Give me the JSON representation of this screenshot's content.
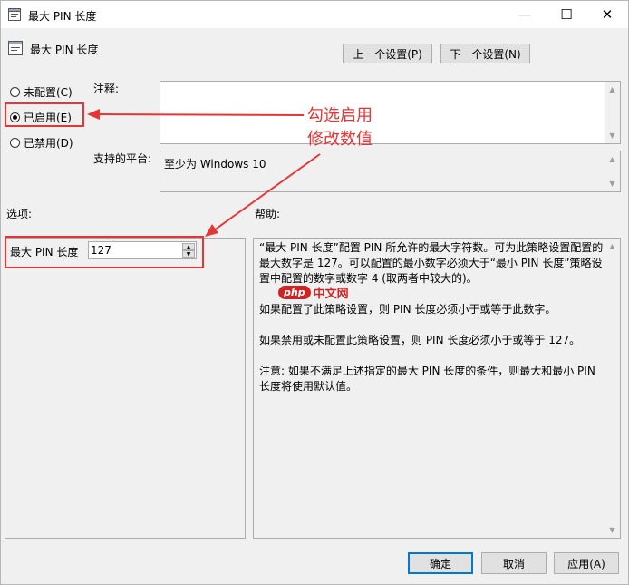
{
  "window": {
    "title": "最大 PIN 长度"
  },
  "header": {
    "policy_title": "最大 PIN 长度",
    "prev_button": "上一个设置(P)",
    "next_button": "下一个设置(N)"
  },
  "state": {
    "options": [
      {
        "label": "未配置(C)",
        "checked": false
      },
      {
        "label": "已启用(E)",
        "checked": true
      },
      {
        "label": "已禁用(D)",
        "checked": false
      }
    ]
  },
  "comment": {
    "label": "注释:",
    "value": ""
  },
  "platform": {
    "label": "支持的平台:",
    "value": "至少为 Windows 10"
  },
  "options_panel": {
    "label": "选项:",
    "max_pin_label": "最大 PIN 长度",
    "max_pin_value": "127"
  },
  "help_panel": {
    "label": "帮助:",
    "paragraphs": [
      "“最大 PIN 长度”配置 PIN 所允许的最大字符数。可为此策略设置配置的最大数字是 127。可以配置的最小数字必须大于“最小 PIN 长度”策略设置中配置的数字或数字 4 (取两者中较大的)。",
      "如果配置了此策略设置，则 PIN 长度必须小于或等于此数字。",
      "如果禁用或未配置此策略设置，则 PIN 长度必须小于或等于 127。",
      "注意: 如果不满足上述指定的最大 PIN 长度的条件，则最大和最小 PIN 长度将使用默认值。"
    ]
  },
  "footer": {
    "ok": "确定",
    "cancel": "取消",
    "apply": "应用(A)"
  },
  "annotation": {
    "line1": "勾选启用",
    "line2": "修改数值",
    "color": "#e53535"
  },
  "watermark": {
    "logo": "php",
    "text": "中文网"
  }
}
